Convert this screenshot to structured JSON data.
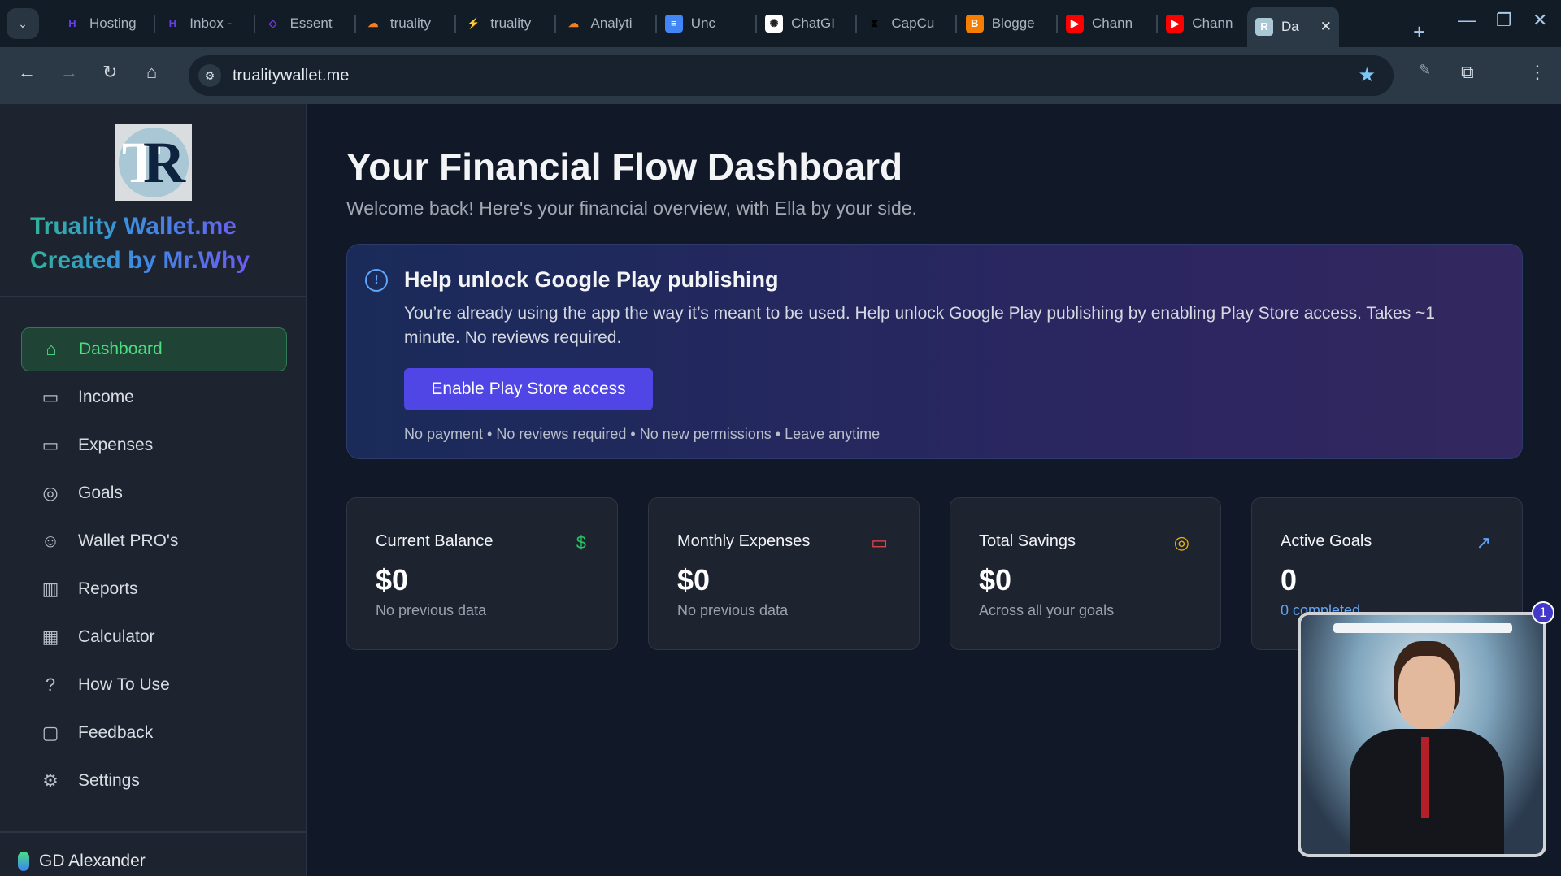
{
  "browser": {
    "tabs": [
      {
        "label": "Hosting",
        "icon": "hostinger-icon",
        "color": "#673de6"
      },
      {
        "label": "Inbox -",
        "icon": "hostinger-mail-icon",
        "color": "#673de6"
      },
      {
        "label": "Essent",
        "icon": "essential-icon",
        "color": "#7c3aed"
      },
      {
        "label": "truality",
        "icon": "cloudflare-icon",
        "color": "#f38020"
      },
      {
        "label": "truality",
        "icon": "supabase-icon",
        "color": "#3ecf8e"
      },
      {
        "label": "Analyti",
        "icon": "cloudflare-icon",
        "color": "#f38020"
      },
      {
        "label": "Unc",
        "icon": "docs-icon",
        "color": "#4285f4"
      },
      {
        "label": "ChatGI",
        "icon": "openai-icon",
        "color": "#ffffff"
      },
      {
        "label": "CapCu",
        "icon": "capcut-icon",
        "color": "#000000"
      },
      {
        "label": "Blogge",
        "icon": "blogger-icon",
        "color": "#f57d00"
      },
      {
        "label": "Chann",
        "icon": "youtube-icon",
        "color": "#ff0000"
      },
      {
        "label": "Chann",
        "icon": "youtube-icon",
        "color": "#ff0000"
      },
      {
        "label": "Da",
        "icon": "truality-icon",
        "color": "#a9c7d4",
        "active": true
      }
    ],
    "url": "trualitywallet.me"
  },
  "sidebar": {
    "brand_line1": "Truality Wallet.me",
    "brand_line2": "Created by Mr.Why",
    "logo_text": "TR",
    "items": [
      {
        "label": "Dashboard",
        "icon": "home-icon",
        "active": true
      },
      {
        "label": "Income",
        "icon": "wallet-icon"
      },
      {
        "label": "Expenses",
        "icon": "credit-card-icon"
      },
      {
        "label": "Goals",
        "icon": "target-icon"
      },
      {
        "label": "Wallet PRO's",
        "icon": "users-icon"
      },
      {
        "label": "Reports",
        "icon": "bar-chart-icon"
      },
      {
        "label": "Calculator",
        "icon": "calculator-icon"
      },
      {
        "label": "How To Use",
        "icon": "help-circle-icon"
      },
      {
        "label": "Feedback",
        "icon": "message-square-icon"
      },
      {
        "label": "Settings",
        "icon": "gear-icon"
      }
    ],
    "user": "GD Alexander"
  },
  "main": {
    "title": "Your Financial Flow Dashboard",
    "subtitle": "Welcome back! Here's your financial overview, with Ella by your side.",
    "banner": {
      "title": "Help unlock Google Play publishing",
      "text": "You’re already using the app the way it’s meant to be used. Help unlock Google Play publishing by enabling Play Store access. Takes ~1 minute. No reviews required.",
      "button": "Enable Play Store access",
      "fine": "No payment • No reviews required • No new permissions • Leave anytime"
    },
    "cards": [
      {
        "title": "Current Balance",
        "value": "$0",
        "sub": "No previous data",
        "icon": "dollar-icon",
        "color": "#22c55e"
      },
      {
        "title": "Monthly Expenses",
        "value": "$0",
        "sub": "No previous data",
        "icon": "credit-card-icon",
        "color": "#ef4444"
      },
      {
        "title": "Total Savings",
        "value": "$0",
        "sub": "Across all your goals",
        "icon": "target-icon",
        "color": "#eab308"
      },
      {
        "title": "Active Goals",
        "value": "0",
        "sub": "0 completed",
        "icon": "trending-up-icon",
        "color": "#60a5fa"
      }
    ],
    "assistant_badge": "1"
  }
}
